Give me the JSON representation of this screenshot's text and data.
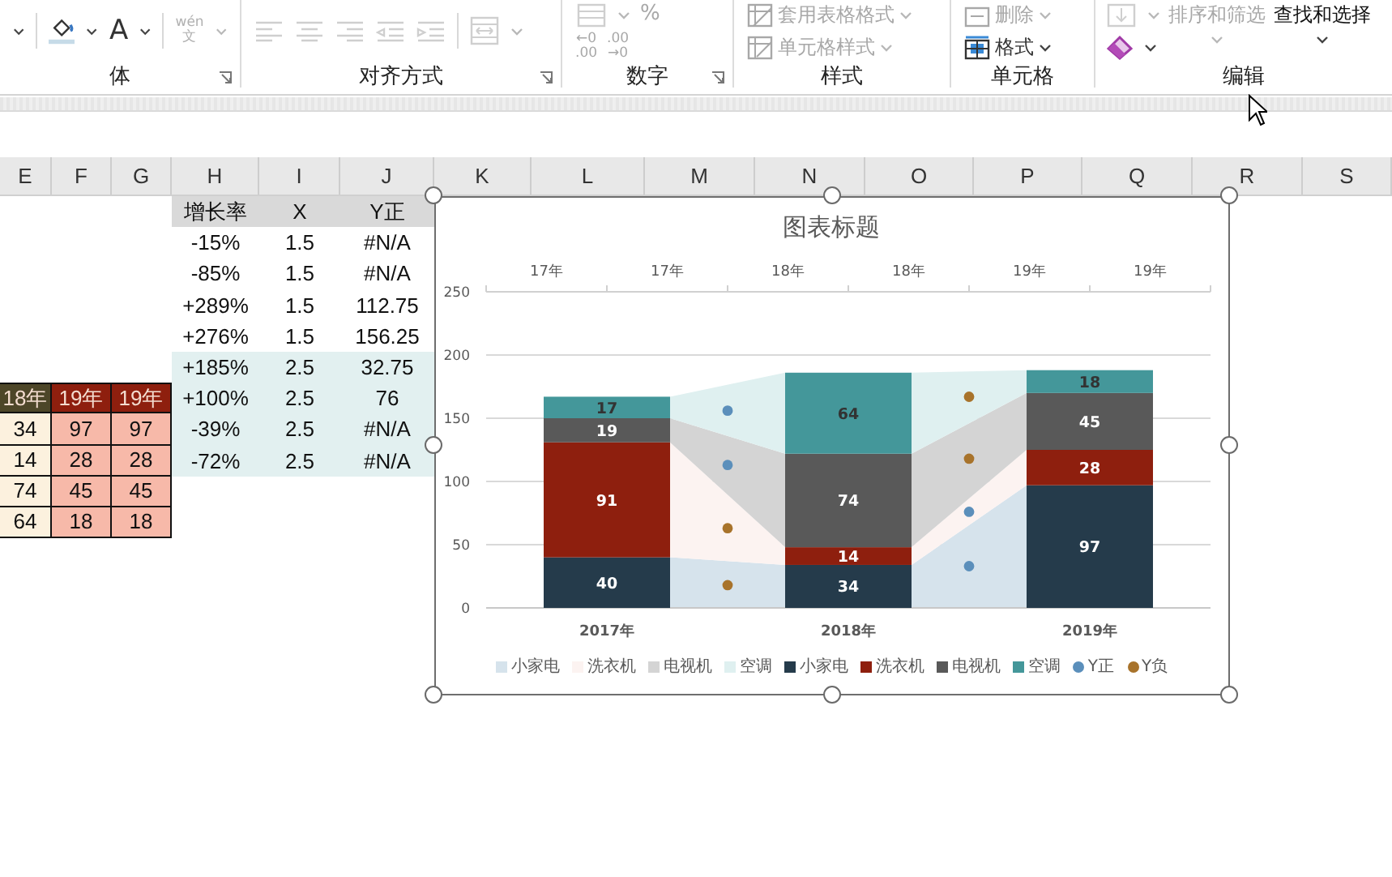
{
  "ribbon": {
    "groups": [
      {
        "label": "体",
        "launcher": true,
        "items": [
          {
            "kind": "caret",
            "disabled": false
          },
          {
            "kind": "separator"
          },
          {
            "kind": "fill-color",
            "disabled": false
          },
          {
            "kind": "caret",
            "disabled": false
          },
          {
            "kind": "font-color",
            "text": "A",
            "disabled": false
          },
          {
            "kind": "caret",
            "disabled": false
          },
          {
            "kind": "separator"
          },
          {
            "kind": "phonetic",
            "text": "wén",
            "sub": "文",
            "disabled": true
          },
          {
            "kind": "caret",
            "disabled": true
          }
        ]
      },
      {
        "label": "对齐方式",
        "launcher": true,
        "items": [
          {
            "kind": "align-left",
            "disabled": true
          },
          {
            "kind": "align-center",
            "disabled": true
          },
          {
            "kind": "align-right",
            "disabled": true
          },
          {
            "kind": "indent-decrease",
            "disabled": true
          },
          {
            "kind": "indent-increase",
            "disabled": true
          },
          {
            "kind": "separator"
          },
          {
            "kind": "merge",
            "disabled": true
          },
          {
            "kind": "caret",
            "disabled": true
          }
        ]
      },
      {
        "label": "数字",
        "launcher": true,
        "items": [
          {
            "kind": "stack",
            "rows": [
              [
                {
                  "kind": "number-format",
                  "disabled": true
                },
                {
                  "kind": "caret",
                  "disabled": true
                },
                {
                  "kind": "percent",
                  "text": "%",
                  "disabled": true
                }
              ],
              [
                {
                  "kind": "decimal",
                  "text": "←0",
                  "sub": ".00",
                  "disabled": true
                },
                {
                  "kind": "decimal",
                  "text": ".00",
                  "sub": "→0",
                  "disabled": true
                }
              ]
            ]
          }
        ]
      },
      {
        "label": "样式",
        "launcher": false,
        "items": [
          {
            "kind": "stack",
            "rows": [
              [
                {
                  "kind": "format-table",
                  "text": "套用表格格式",
                  "disabled": true
                }
              ],
              [
                {
                  "kind": "cell-styles",
                  "text": "单元格样式",
                  "disabled": true
                }
              ]
            ]
          }
        ]
      },
      {
        "label": "单元格",
        "launcher": false,
        "items": [
          {
            "kind": "stack",
            "rows": [
              [
                {
                  "kind": "delete",
                  "text": "删除",
                  "disabled": true
                }
              ],
              [
                {
                  "kind": "format",
                  "text": "格式",
                  "disabled": false
                }
              ]
            ]
          }
        ]
      },
      {
        "label": "编辑",
        "launcher": false,
        "items": [
          {
            "kind": "stack",
            "rows": [
              [
                {
                  "kind": "fill-down",
                  "disabled": true
                },
                {
                  "kind": "caret",
                  "disabled": true
                }
              ],
              [
                {
                  "kind": "clear",
                  "disabled": false
                },
                {
                  "kind": "caret",
                  "disabled": false
                }
              ]
            ]
          },
          {
            "kind": "sort",
            "text": "排序和筛选",
            "disabled": true
          },
          {
            "kind": "find",
            "text": "查找和选择",
            "disabled": false
          }
        ]
      }
    ]
  },
  "sheet": {
    "columns": [
      "E",
      "F",
      "G",
      "H",
      "I",
      "J",
      "K",
      "L",
      "M",
      "N",
      "O",
      "P",
      "Q",
      "R",
      "S"
    ],
    "left_table": {
      "columns": [
        {
          "header": {
            "text": "18年",
            "color": "#4d4628"
          },
          "color": "#fcf1de"
        },
        {
          "header": {
            "text": "19年",
            "color": "#8e1f0e"
          },
          "color": "#f7b9a9"
        },
        {
          "header": {
            "text": "19年",
            "color": "#8e1f0e"
          },
          "color": "#f7b9a9"
        }
      ],
      "rows": [
        [
          "34",
          "97",
          "97"
        ],
        [
          "14",
          "28",
          "28"
        ],
        [
          "74",
          "45",
          "45"
        ],
        [
          "64",
          "18",
          "18"
        ]
      ]
    },
    "right_table": {
      "headers": [
        "增长率",
        "X",
        "Y正"
      ],
      "rows": [
        {
          "cells": [
            "-15%",
            "1.5",
            "#N/A"
          ],
          "highlighted": false
        },
        {
          "cells": [
            "-85%",
            "1.5",
            "#N/A"
          ],
          "highlighted": false
        },
        {
          "cells": [
            "+289%",
            "1.5",
            "112.75"
          ],
          "highlighted": false
        },
        {
          "cells": [
            "+276%",
            "1.5",
            "156.25"
          ],
          "highlighted": false
        },
        {
          "cells": [
            "+185%",
            "2.5",
            "32.75"
          ],
          "highlighted": true
        },
        {
          "cells": [
            "+100%",
            "2.5",
            "76"
          ],
          "highlighted": true
        },
        {
          "cells": [
            "-39%",
            "2.5",
            "#N/A"
          ],
          "highlighted": true
        },
        {
          "cells": [
            "-72%",
            "2.5",
            "#N/A"
          ],
          "highlighted": true
        }
      ]
    },
    "chart": {
      "selected": true,
      "top_axis_labels": [
        "17年",
        "17年",
        "18年",
        "18年",
        "19年",
        "19年"
      ],
      "legend": [
        {
          "label": "小家电",
          "kind": "area",
          "color": "#d6e3ec"
        },
        {
          "label": "洗衣机",
          "kind": "area",
          "color": "#fcf3f1"
        },
        {
          "label": "电视机",
          "kind": "area",
          "color": "#d4d4d4"
        },
        {
          "label": "空调",
          "kind": "area",
          "color": "#dff0f0"
        },
        {
          "kind": "column"
        },
        {
          "kind": "column"
        },
        {
          "kind": "column"
        },
        {
          "kind": "column"
        },
        {
          "label": "Y正",
          "kind": "point",
          "color": "#5b8fbb"
        },
        {
          "label": "Y负",
          "kind": "point",
          "color": "#a8732b"
        }
      ],
      "chart_data": {
        "type": "bar",
        "orientation": "vertical",
        "stacked": true,
        "title": "图表标题",
        "categories": [
          "2017年",
          "2018年",
          "2019年"
        ],
        "ylim": [
          0,
          250
        ],
        "yticks": [
          0,
          50,
          100,
          150,
          200,
          250
        ],
        "grid": true,
        "data_labels": true,
        "series": [
          {
            "name": "小家电",
            "color": "#253b4b",
            "values": [
              40,
              34,
              97
            ]
          },
          {
            "name": "洗衣机",
            "color": "#8e1f0e",
            "values": [
              91,
              14,
              28
            ]
          },
          {
            "name": "电视机",
            "color": "#595959",
            "values": [
              19,
              74,
              45
            ]
          },
          {
            "name": "空调",
            "color": "#44979a",
            "values": [
              17,
              64,
              18
            ]
          }
        ]
      }
    }
  }
}
